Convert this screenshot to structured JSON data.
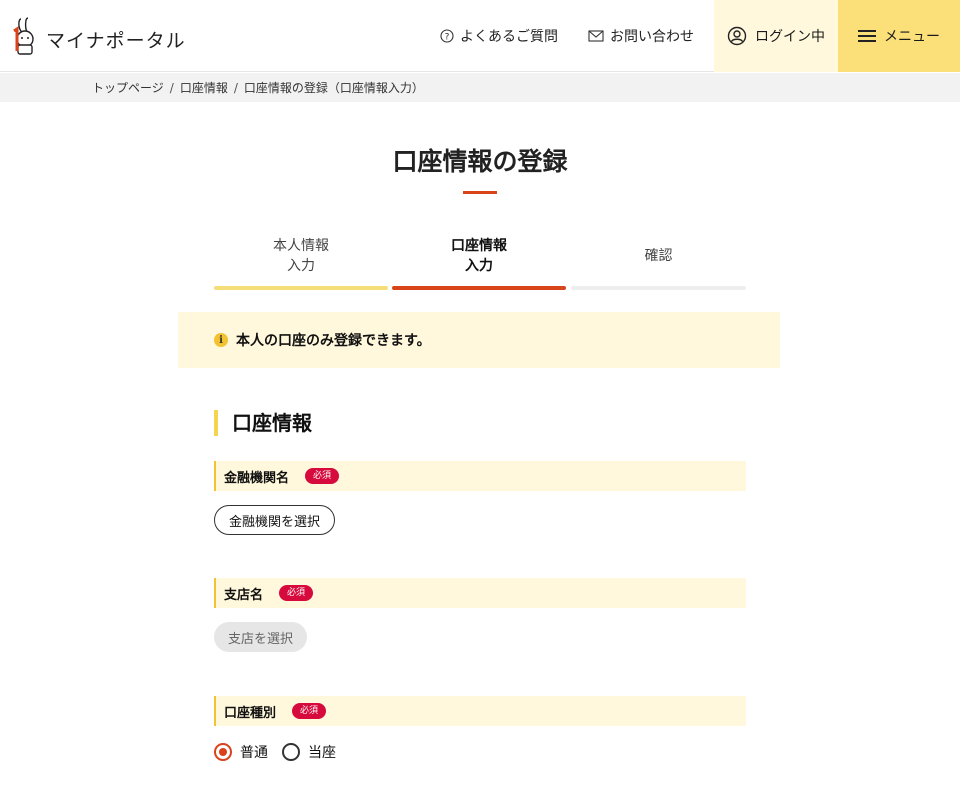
{
  "header": {
    "logo_text": "マイナポータル",
    "faq_label": "よくあるご質問",
    "contact_label": "お問い合わせ",
    "login_label": "ログイン中",
    "menu_label": "メニュー"
  },
  "breadcrumb": [
    "トップページ",
    "口座情報",
    "口座情報の登録（口座情報入力）"
  ],
  "page": {
    "title": "口座情報の登録"
  },
  "steps": [
    {
      "line1": "本人情報",
      "line2": "入力",
      "state": "done"
    },
    {
      "line1": "口座情報",
      "line2": "入力",
      "state": "current"
    },
    {
      "line1": "確認",
      "line2": "",
      "state": "upcoming"
    }
  ],
  "notice": {
    "icon": "info-icon",
    "glyph": "i",
    "text": "本人の口座のみ登録できます。"
  },
  "section": {
    "heading": "口座情報"
  },
  "fields": {
    "bank": {
      "label": "金融機関名",
      "required": "必須",
      "button": "金融機関を選択"
    },
    "branch": {
      "label": "支店名",
      "required": "必須",
      "button": "支店を選択"
    },
    "account_type": {
      "label": "口座種別",
      "required": "必須",
      "options": [
        {
          "label": "普通",
          "checked": true
        },
        {
          "label": "当座",
          "checked": false
        }
      ]
    }
  },
  "colors": {
    "accent_red": "#d9431a",
    "accent_yellow": "#fbe07a",
    "light_yellow": "#fff8dc",
    "required_badge": "#d60a3c"
  }
}
